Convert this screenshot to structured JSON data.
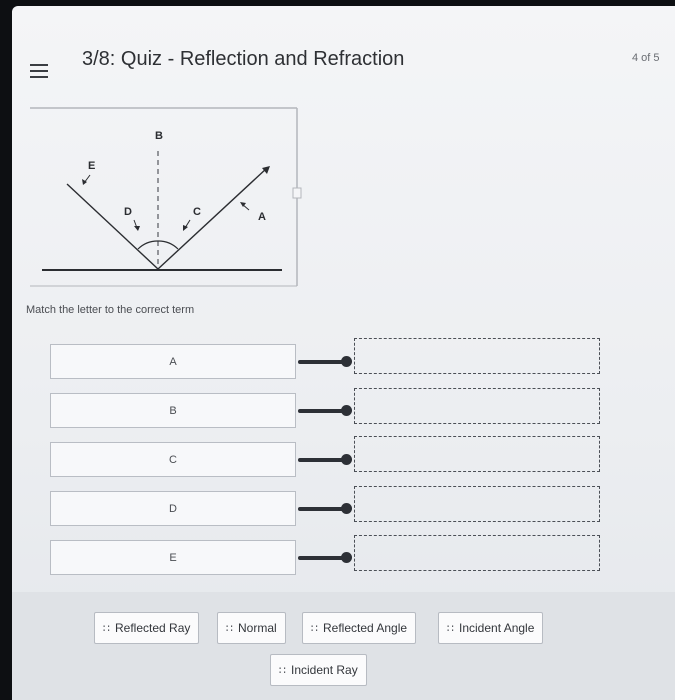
{
  "header": {
    "title": "3/8: Quiz - Reflection and Refraction",
    "counter": "4 of 5"
  },
  "diagram": {
    "labels": {
      "B": "B",
      "E": "E",
      "D": "D",
      "C": "C",
      "A": "A"
    }
  },
  "instructions": "Match the letter to the correct term",
  "terms": [
    "A",
    "B",
    "C",
    "D",
    "E"
  ],
  "answer_choices": [
    "Reflected Ray",
    "Normal",
    "Reflected Angle",
    "Incident Angle",
    "Incident Ray"
  ],
  "icons": {
    "menu": "hamburger-menu-icon",
    "grip": "drag-handle-icon"
  }
}
